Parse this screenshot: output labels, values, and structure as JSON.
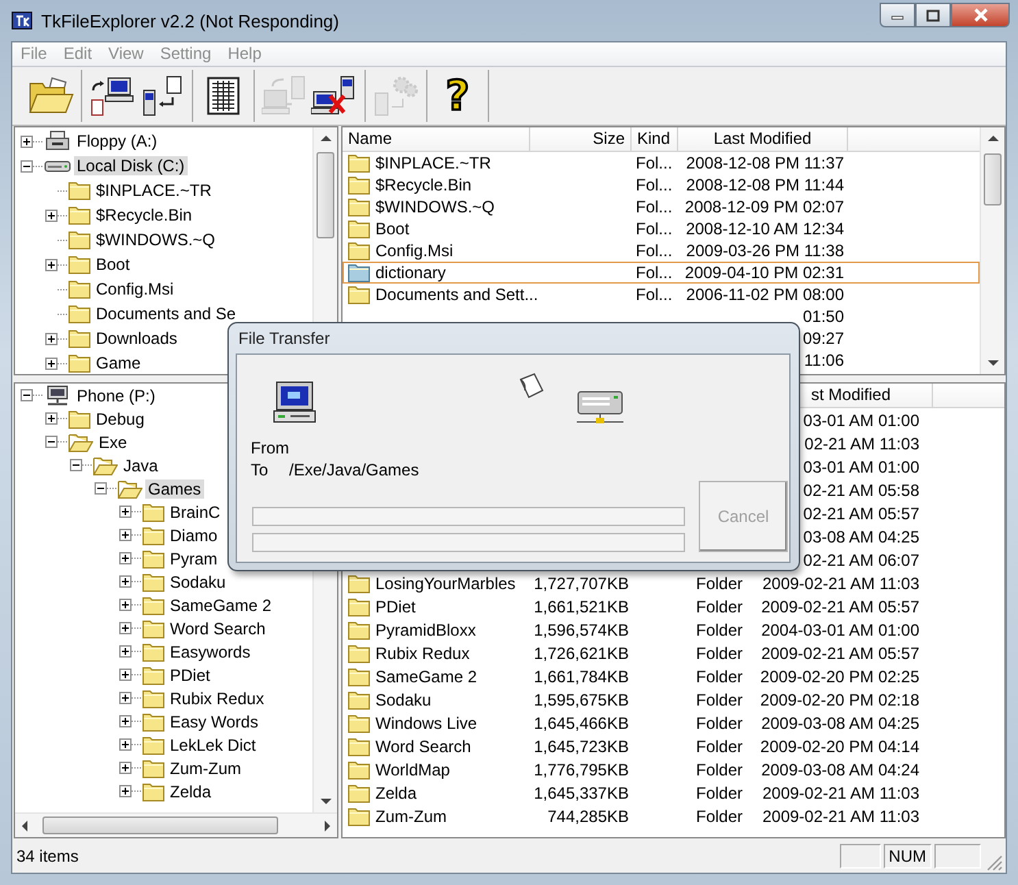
{
  "window": {
    "title": "TkFileExplorer v2.2 (Not Responding)"
  },
  "menu": [
    {
      "label": "File",
      "disabled": true
    },
    {
      "label": "Edit",
      "disabled": true
    },
    {
      "label": "View",
      "disabled": true
    },
    {
      "label": "Setting",
      "disabled": true
    },
    {
      "label": "Help",
      "disabled": true
    }
  ],
  "toolbar": {
    "groups": [
      {
        "buttons": [
          {
            "kind": "open",
            "disabled": false
          }
        ]
      },
      {
        "buttons": [
          {
            "kind": "to-pc",
            "disabled": false
          },
          {
            "kind": "to-phone",
            "disabled": false
          }
        ]
      },
      {
        "buttons": [
          {
            "kind": "list",
            "disabled": false
          }
        ]
      },
      {
        "buttons": [
          {
            "kind": "sync",
            "disabled": true
          },
          {
            "kind": "disconnect",
            "disabled": false
          }
        ]
      },
      {
        "buttons": [
          {
            "kind": "settings",
            "disabled": true
          }
        ]
      },
      {
        "buttons": [
          {
            "kind": "help",
            "disabled": false,
            "glyph": "?"
          }
        ]
      }
    ]
  },
  "upper_tree": {
    "items": [
      {
        "label": "Floppy (A:)",
        "kind": "floppy",
        "expandable": true,
        "expanded": false,
        "selected": false
      },
      {
        "label": "Local Disk (C:)",
        "kind": "disk",
        "expandable": true,
        "expanded": true,
        "selected": true,
        "children": [
          {
            "label": "$INPLACE.~TR",
            "kind": "folder",
            "expandable": false,
            "expanded": false,
            "selected": false
          },
          {
            "label": "$Recycle.Bin",
            "kind": "folder",
            "expandable": true,
            "expanded": false,
            "selected": false
          },
          {
            "label": "$WINDOWS.~Q",
            "kind": "folder",
            "expandable": false,
            "expanded": false,
            "selected": false
          },
          {
            "label": "Boot",
            "kind": "folder",
            "expandable": true,
            "expanded": false,
            "selected": false
          },
          {
            "label": "Config.Msi",
            "kind": "folder",
            "expandable": false,
            "expanded": false,
            "selected": false
          },
          {
            "label": "Documents and Se",
            "kind": "folder",
            "expandable": false,
            "expanded": false,
            "selected": false
          },
          {
            "label": "Downloads",
            "kind": "folder",
            "expandable": true,
            "expanded": false,
            "selected": false
          },
          {
            "label": "Game",
            "kind": "folder",
            "expandable": true,
            "expanded": false,
            "selected": false
          }
        ]
      }
    ]
  },
  "upper_list": {
    "columns": [
      "Name",
      "Size",
      "Kind",
      "Last Modified"
    ],
    "rows": [
      {
        "name": "$INPLACE.~TR",
        "file_kind": "Fol...",
        "modified": "2008-12-08 PM 11:37",
        "selected": false
      },
      {
        "name": "$Recycle.Bin",
        "file_kind": "Fol...",
        "modified": "2008-12-08 PM 11:44",
        "selected": false
      },
      {
        "name": "$WINDOWS.~Q",
        "file_kind": "Fol...",
        "modified": "2008-12-09 PM 02:07",
        "selected": false
      },
      {
        "name": "Boot",
        "file_kind": "Fol...",
        "modified": "2008-12-10 AM 12:34",
        "selected": false
      },
      {
        "name": "Config.Msi",
        "file_kind": "Fol...",
        "modified": "2009-03-26 PM 11:38",
        "selected": false
      },
      {
        "name": "dictionary",
        "file_kind": "Fol...",
        "modified": "2009-04-10 PM 02:31",
        "selected": true
      },
      {
        "name": "Documents and Sett...",
        "file_kind": "Fol...",
        "modified": "2006-11-02 PM 08:00",
        "selected": false
      },
      {
        "modified": "01:50",
        "selected": false
      },
      {
        "modified": "09:27",
        "selected": false
      },
      {
        "modified": "11:06",
        "selected": false
      }
    ]
  },
  "lower_tree": {
    "items": [
      {
        "label": "Phone (P:)",
        "kind": "phone",
        "expandable": true,
        "expanded": true,
        "selected": false,
        "children": [
          {
            "label": "Debug",
            "kind": "folder",
            "expandable": true,
            "expanded": false,
            "selected": false
          },
          {
            "label": "Exe",
            "kind": "folder",
            "expandable": true,
            "expanded": true,
            "selected": false,
            "children": [
              {
                "label": "Java",
                "kind": "folder",
                "expandable": true,
                "expanded": true,
                "selected": false,
                "children": [
                  {
                    "label": "Games",
                    "kind": "folder",
                    "expandable": true,
                    "expanded": true,
                    "selected": true,
                    "children": [
                      {
                        "label": "BrainC",
                        "kind": "folder",
                        "expandable": true,
                        "expanded": false,
                        "selected": false
                      },
                      {
                        "label": "Diamo",
                        "kind": "folder",
                        "expandable": true,
                        "expanded": false,
                        "selected": false
                      },
                      {
                        "label": "Pyram",
                        "kind": "folder",
                        "expandable": true,
                        "expanded": false,
                        "selected": false
                      },
                      {
                        "label": "Sodaku",
                        "kind": "folder",
                        "expandable": true,
                        "expanded": false,
                        "selected": false
                      },
                      {
                        "label": "SameGame 2",
                        "kind": "folder",
                        "expandable": true,
                        "expanded": false,
                        "selected": false
                      },
                      {
                        "label": "Word Search",
                        "kind": "folder",
                        "expandable": true,
                        "expanded": false,
                        "selected": false
                      },
                      {
                        "label": "Easywords",
                        "kind": "folder",
                        "expandable": true,
                        "expanded": false,
                        "selected": false
                      },
                      {
                        "label": "PDiet",
                        "kind": "folder",
                        "expandable": true,
                        "expanded": false,
                        "selected": false
                      },
                      {
                        "label": "Rubix Redux",
                        "kind": "folder",
                        "expandable": true,
                        "expanded": false,
                        "selected": false
                      },
                      {
                        "label": "Easy Words",
                        "kind": "folder",
                        "expandable": true,
                        "expanded": false,
                        "selected": false
                      },
                      {
                        "label": "LekLek Dict",
                        "kind": "folder",
                        "expandable": true,
                        "expanded": false,
                        "selected": false
                      },
                      {
                        "label": "Zum-Zum",
                        "kind": "folder",
                        "expandable": true,
                        "expanded": false,
                        "selected": false
                      },
                      {
                        "label": "Zelda",
                        "kind": "folder",
                        "expandable": true,
                        "expanded": false,
                        "selected": false
                      }
                    ]
                  }
                ]
              }
            ]
          }
        ]
      }
    ]
  },
  "lower_list": {
    "columns": [
      "st Modified"
    ],
    "rows": [
      {
        "modified": "03-01 AM 01:00",
        "selected": false
      },
      {
        "modified": "02-21 AM 11:03",
        "selected": false
      },
      {
        "modified": "03-01 AM 01:00",
        "selected": false
      },
      {
        "modified": "02-21 AM 05:58",
        "selected": false
      },
      {
        "modified": "02-21 AM 05:57",
        "selected": false
      },
      {
        "modified": "03-08 AM 04:25",
        "selected": false
      },
      {
        "modified": "02-21 AM 06:07",
        "selected": false
      },
      {
        "name": "LosingYourMarbles",
        "size": "1,727,707KB",
        "file_kind": "Folder",
        "modified": "2009-02-21 AM 11:03",
        "selected": false
      },
      {
        "name": "PDiet",
        "size": "1,661,521KB",
        "file_kind": "Folder",
        "modified": "2009-02-21 AM 05:57",
        "selected": false
      },
      {
        "name": "PyramidBloxx",
        "size": "1,596,574KB",
        "file_kind": "Folder",
        "modified": "2004-03-01 AM 01:00",
        "selected": false
      },
      {
        "name": "Rubix Redux",
        "size": "1,726,621KB",
        "file_kind": "Folder",
        "modified": "2009-02-21 AM 05:57",
        "selected": false
      },
      {
        "name": "SameGame 2",
        "size": "1,661,784KB",
        "file_kind": "Folder",
        "modified": "2009-02-20 PM 02:25",
        "selected": false
      },
      {
        "name": "Sodaku",
        "size": "1,595,675KB",
        "file_kind": "Folder",
        "modified": "2009-02-20 PM 02:18",
        "selected": false
      },
      {
        "name": "Windows Live",
        "size": "1,645,466KB",
        "file_kind": "Folder",
        "modified": "2009-03-08 AM 04:25",
        "selected": false
      },
      {
        "name": "Word Search",
        "size": "1,645,723KB",
        "file_kind": "Folder",
        "modified": "2009-02-20 PM 04:14",
        "selected": false
      },
      {
        "name": "WorldMap",
        "size": "1,776,795KB",
        "file_kind": "Folder",
        "modified": "2009-03-08 AM 04:24",
        "selected": false
      },
      {
        "name": "Zelda",
        "size": "1,645,337KB",
        "file_kind": "Folder",
        "modified": "2009-02-21 AM 11:03",
        "selected": false
      },
      {
        "name": "Zum-Zum",
        "size": "744,285KB",
        "file_kind": "Folder",
        "modified": "2009-02-21 AM 11:03",
        "selected": false
      }
    ]
  },
  "status_bar": {
    "text": "34 items",
    "indicators": [
      "NUM"
    ]
  },
  "dialog": {
    "title": "File Transfer",
    "from_label": "From",
    "to_label": "To",
    "to_value": "/Exe/Java/Games",
    "progress": [
      {
        "level": 0
      },
      {
        "level": 0
      }
    ],
    "cancel": {
      "label": "Cancel",
      "disabled": true
    }
  }
}
